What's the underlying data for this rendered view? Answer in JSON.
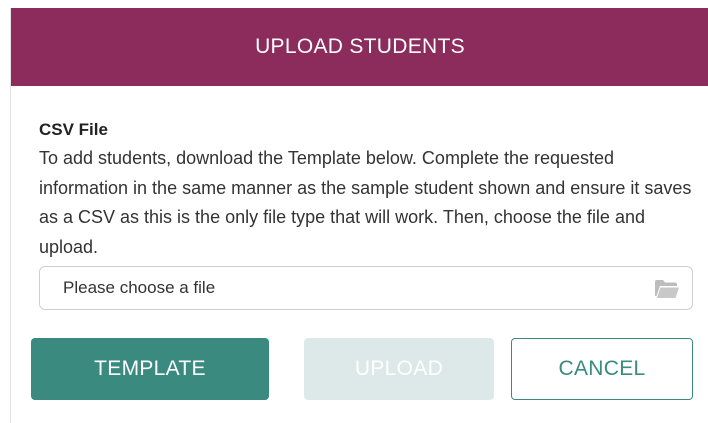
{
  "modal": {
    "title": "UPLOAD STUDENTS",
    "field_label": "CSV File",
    "instructions": "To add students, download the Template below. Complete the requested information in the same manner as the sample student shown and ensure it saves as a CSV as this is the only file type that will work. Then, choose the file and upload.",
    "file_input": {
      "placeholder": "Please choose a file",
      "icon": "folder-icon"
    },
    "buttons": {
      "template_label": "TEMPLATE",
      "upload_label": "UPLOAD",
      "cancel_label": "CANCEL"
    }
  },
  "colors": {
    "header_bg": "#8b2c5c",
    "primary_teal": "#3a8a80",
    "disabled_button_bg": "#dde9e8"
  }
}
